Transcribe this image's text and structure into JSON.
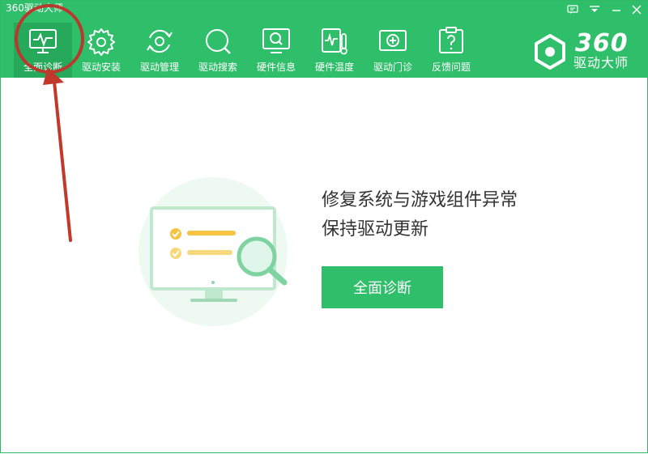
{
  "window": {
    "title": "360驱动大师"
  },
  "nav": [
    {
      "label": "全面诊断",
      "icon": "monitor-pulse-icon"
    },
    {
      "label": "驱动安装",
      "icon": "gear-icon"
    },
    {
      "label": "驱动管理",
      "icon": "refresh-gear-icon"
    },
    {
      "label": "驱动搜索",
      "icon": "search-icon"
    },
    {
      "label": "硬件信息",
      "icon": "monitor-search-icon"
    },
    {
      "label": "硬件温度",
      "icon": "thermometer-icon"
    },
    {
      "label": "驱动门诊",
      "icon": "medical-kit-icon"
    },
    {
      "label": "反馈问题",
      "icon": "question-clipboard-icon"
    }
  ],
  "logo": {
    "number": "360",
    "name": "驱动大师"
  },
  "main": {
    "headline": "修复系统与游戏组件异常",
    "subline": "保持驱动更新",
    "button": "全面诊断"
  },
  "colors": {
    "brand": "#2fbe69",
    "active_tab": "#26a95b",
    "annotation": "#c0392b"
  }
}
